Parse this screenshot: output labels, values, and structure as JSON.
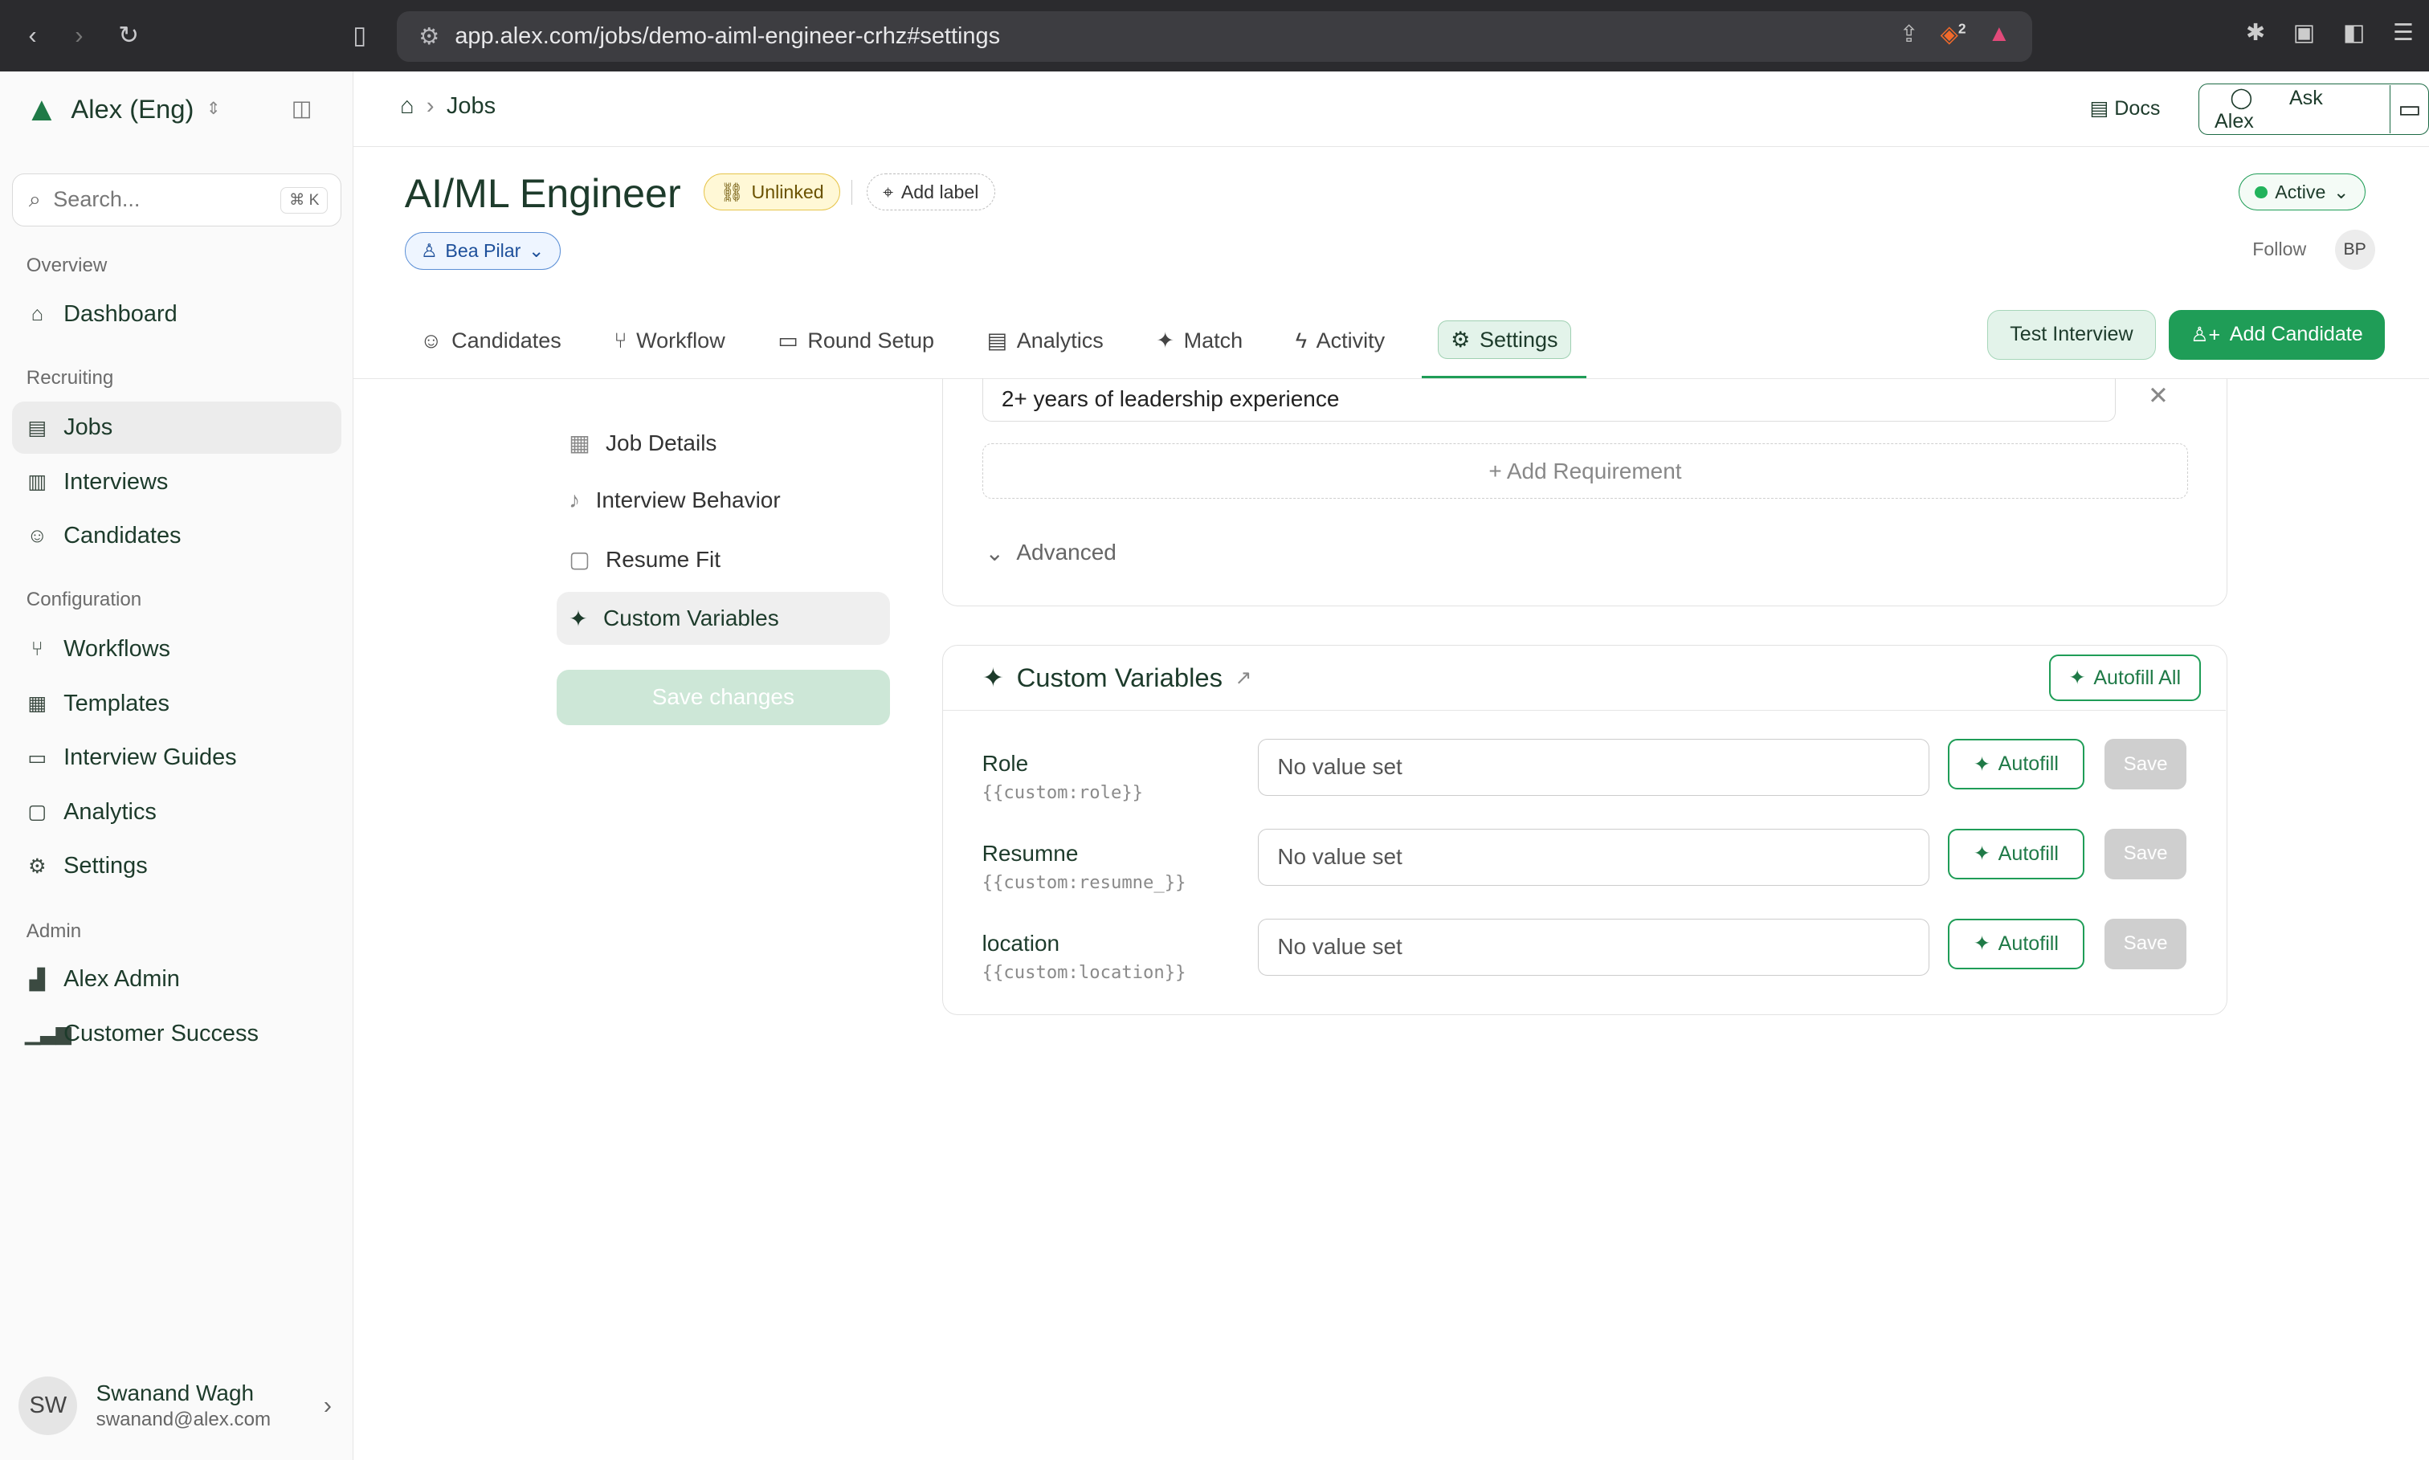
{
  "browser": {
    "url": "app.alex.com/jobs/demo-aiml-engineer-crhz#settings",
    "brave_badge": "2"
  },
  "sidebar": {
    "org": "Alex (Eng)",
    "search_placeholder": "Search...",
    "search_shortcut": "⌘ K",
    "sections": {
      "overview": "Overview",
      "recruiting": "Recruiting",
      "configuration": "Configuration",
      "admin": "Admin"
    },
    "items": {
      "dashboard": "Dashboard",
      "jobs": "Jobs",
      "interviews": "Interviews",
      "candidates": "Candidates",
      "workflows": "Workflows",
      "templates": "Templates",
      "guides": "Interview Guides",
      "analytics": "Analytics",
      "settings": "Settings",
      "alex_admin": "Alex Admin",
      "cs": "Customer Success"
    },
    "user": {
      "initials": "SW",
      "name": "Swanand Wagh",
      "email": "swanand@alex.com"
    }
  },
  "header": {
    "breadcrumb": "Jobs",
    "docs": "Docs",
    "ask": "Ask Alex"
  },
  "job": {
    "title": "AI/ML Engineer",
    "link_status": "Unlinked",
    "add_label": "Add label",
    "owner": "Bea Pilar",
    "status": "Active",
    "follow": "Follow",
    "follower_initials": "BP"
  },
  "tabs": {
    "candidates": "Candidates",
    "workflow": "Workflow",
    "round_setup": "Round Setup",
    "analytics": "Analytics",
    "match": "Match",
    "activity": "Activity",
    "settings": "Settings"
  },
  "actions": {
    "test_interview": "Test Interview",
    "add_candidate": "Add Candidate"
  },
  "settings_nav": {
    "job_details": "Job Details",
    "interview_behavior": "Interview Behavior",
    "resume_fit": "Resume Fit",
    "custom_variables": "Custom Variables",
    "save": "Save changes"
  },
  "requirements": {
    "last": "2+ years of leadership experience",
    "add": "+ Add Requirement",
    "advanced": "Advanced"
  },
  "custom_vars": {
    "title": "Custom Variables",
    "autofill_all": "Autofill All",
    "autofill": "Autofill",
    "save": "Save",
    "rows": [
      {
        "label": "Role",
        "code": "{{custom:role}}",
        "value": "No value set"
      },
      {
        "label": "Resumne",
        "code": "{{custom:resumne_}}",
        "value": "No value set"
      },
      {
        "label": "location",
        "code": "{{custom:location}}",
        "value": "No value set"
      }
    ]
  }
}
